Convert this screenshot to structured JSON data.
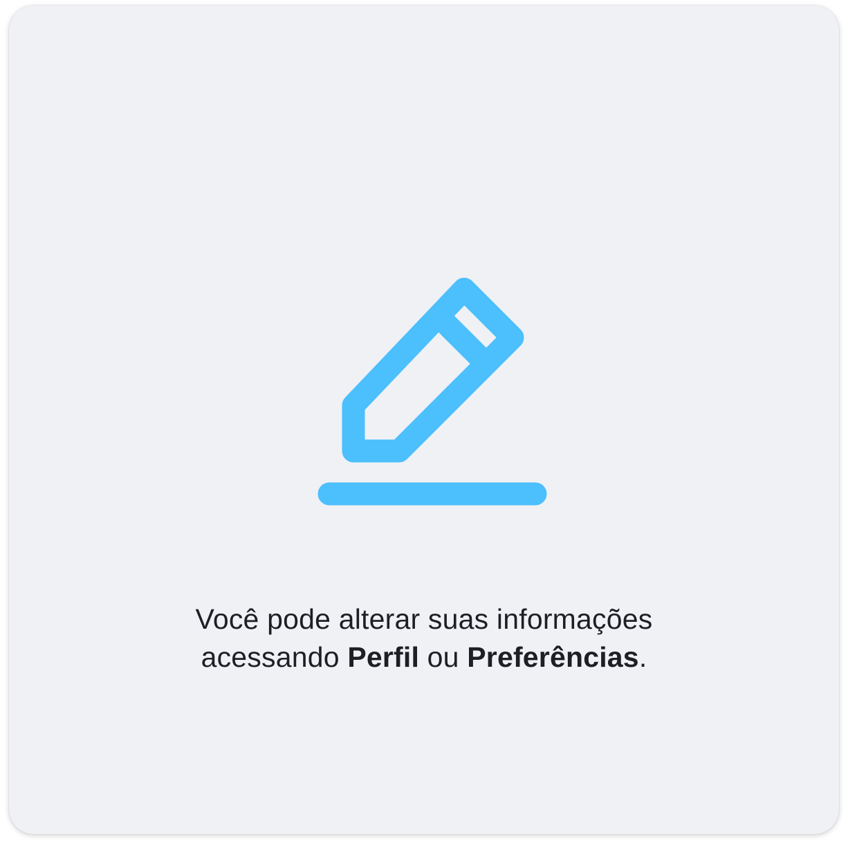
{
  "icon": {
    "name": "edit-pencil-icon",
    "color": "#4cbffd"
  },
  "message": {
    "line1": "Você pode alterar suas informações",
    "line2_prefix": "acessando ",
    "link_profile": "Perfil",
    "connector": " ou ",
    "link_preferences": "Preferências",
    "suffix": "."
  },
  "colors": {
    "card_background": "#eff1f5",
    "text": "#1e1f24",
    "accent": "#4cbffd"
  }
}
